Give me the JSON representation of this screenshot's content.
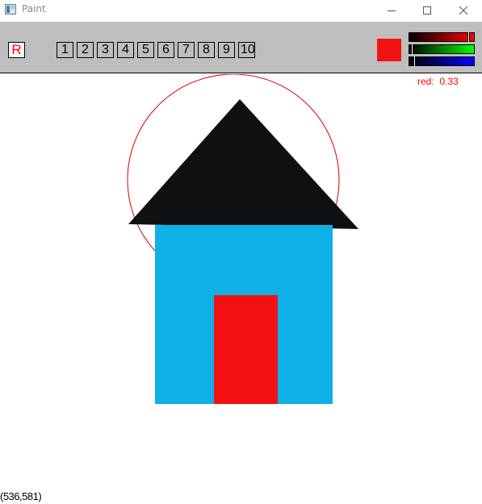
{
  "window": {
    "title": "Paint"
  },
  "toolbar": {
    "reset_label": "R",
    "sizes": [
      "1",
      "2",
      "3",
      "4",
      "5",
      "6",
      "7",
      "8",
      "9",
      "10"
    ],
    "current_color": "#f31212",
    "sliders": {
      "red": 0.93,
      "green": 0.02,
      "blue": 0.06
    }
  },
  "readout": {
    "label": "red:",
    "value": "0.33"
  },
  "status": {
    "coords": "(536,581)"
  },
  "drawing": {
    "roof_color": "#0e1012",
    "wall_color": "#0eb1e6",
    "door_color": "#f31212",
    "circle_color": "#d40000"
  }
}
